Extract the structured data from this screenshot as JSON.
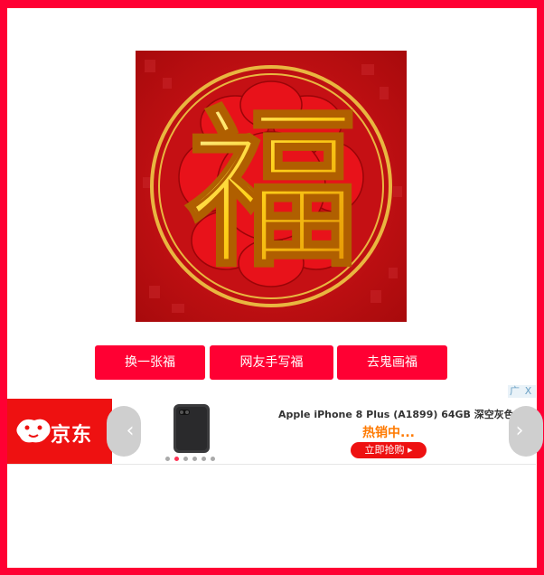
{
  "fu_image": {
    "character": "福",
    "icon": "fu-character-image"
  },
  "buttons": {
    "change": "换一张福",
    "handwrite": "网友手写福",
    "ghost": "去鬼画福"
  },
  "ad": {
    "close_labels": [
      "广",
      "X"
    ],
    "brand": "京东",
    "product_title": "Apple iPhone 8 Plus (A1899) 64GB 深空灰色 ...",
    "hot_text": "热销中...",
    "buy_text": "立即抢购 ▸",
    "nav_prev": "‹",
    "nav_next": "›",
    "dots_count": 6,
    "dots_active": 2
  },
  "colors": {
    "frame": "#ff0033",
    "button": "#ff0033",
    "jd_red": "#ee1111",
    "hot_orange": "#ff7a00"
  }
}
